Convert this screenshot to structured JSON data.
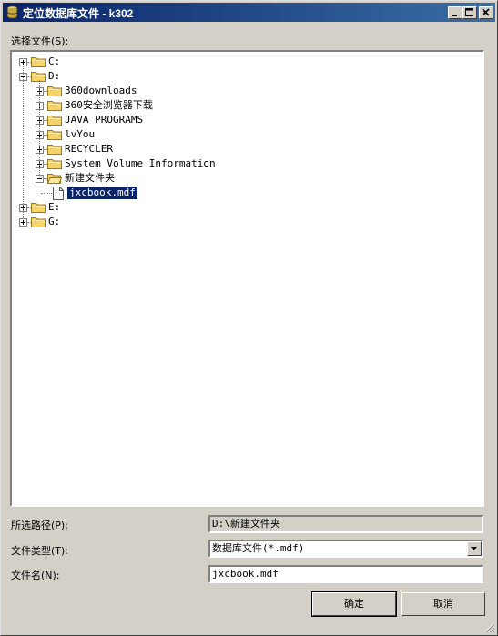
{
  "window": {
    "title": "定位数据库文件 - k302"
  },
  "tree": {
    "label": "选择文件(S):",
    "nodes": [
      {
        "id": "c",
        "label": "C:",
        "level": 0,
        "expander": "plus",
        "icon": "folder"
      },
      {
        "id": "d",
        "label": "D:",
        "level": 0,
        "expander": "minus",
        "icon": "folder"
      },
      {
        "id": "d1",
        "label": "360downloads",
        "level": 1,
        "expander": "plus",
        "icon": "folder"
      },
      {
        "id": "d2",
        "label": "360安全浏览器下载",
        "level": 1,
        "expander": "plus",
        "icon": "folder"
      },
      {
        "id": "d3",
        "label": "JAVA PROGRAMS",
        "level": 1,
        "expander": "plus",
        "icon": "folder"
      },
      {
        "id": "d4",
        "label": "lvYou",
        "level": 1,
        "expander": "plus",
        "icon": "folder"
      },
      {
        "id": "d5",
        "label": "RECYCLER",
        "level": 1,
        "expander": "plus",
        "icon": "folder"
      },
      {
        "id": "d6",
        "label": "System Volume Information",
        "level": 1,
        "expander": "plus",
        "icon": "folder"
      },
      {
        "id": "d7",
        "label": "新建文件夹",
        "level": 1,
        "expander": "minus",
        "icon": "folder-open"
      },
      {
        "id": "f1",
        "label": "jxcbook.mdf",
        "level": 2,
        "expander": "none",
        "icon": "file",
        "selected": true
      },
      {
        "id": "e",
        "label": "E:",
        "level": 0,
        "expander": "plus",
        "icon": "folder"
      },
      {
        "id": "g",
        "label": "G:",
        "level": 0,
        "expander": "plus",
        "icon": "folder"
      }
    ]
  },
  "form": {
    "path_label": "所选路径(P):",
    "path_value": "D:\\新建文件夹",
    "type_label": "文件类型(T):",
    "type_value": "数据库文件(*.mdf)",
    "name_label": "文件名(N):",
    "name_value": "jxcbook.mdf"
  },
  "buttons": {
    "ok": "确定",
    "cancel": "取消"
  },
  "colors": {
    "titlebar_start": "#0a246a",
    "titlebar_end": "#3a6ea5",
    "selection": "#0a246a",
    "folder": "#f5d56a"
  }
}
